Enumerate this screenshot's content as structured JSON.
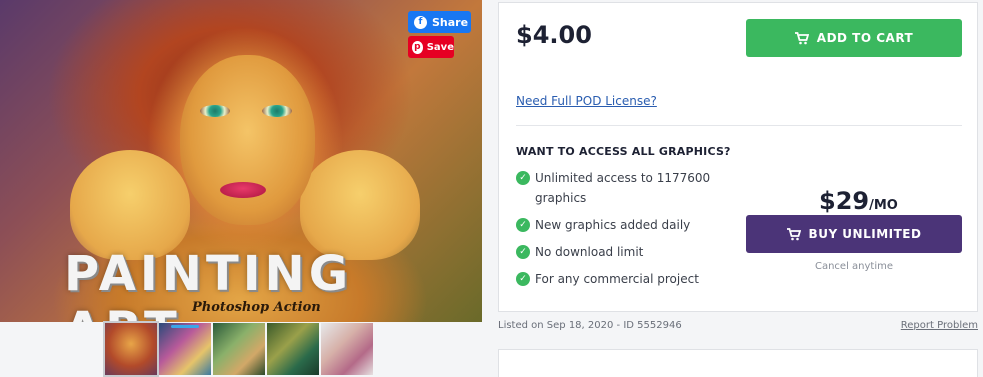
{
  "product_image": {
    "title_text": "PAINTING ART",
    "subtitle_text": "Photoshop Action"
  },
  "social": {
    "share_label": "Share",
    "save_label": "Save"
  },
  "thumbnails": {
    "count": 5,
    "active_index": 0
  },
  "purchase": {
    "price": "$4.00",
    "add_to_cart_label": "ADD TO CART",
    "pod_license_link": "Need Full POD License?",
    "want_access_heading": "WANT TO ACCESS ALL GRAPHICS?",
    "features": [
      "Unlimited access to 1177600 graphics",
      "New graphics added daily",
      "No download limit",
      "For any commercial project"
    ],
    "unlimited_price": "$29",
    "unlimited_period": "/MO",
    "buy_unlimited_label": "BUY UNLIMITED",
    "cancel_text": "Cancel anytime"
  },
  "meta": {
    "listed_text": "Listed on Sep 18, 2020 - ID 5552946",
    "report_link": "Report Problem"
  },
  "colors": {
    "green": "#3bb85f",
    "purple": "#4b3478",
    "facebook": "#1877f2",
    "pinterest": "#e60023",
    "link": "#2a5db0"
  }
}
